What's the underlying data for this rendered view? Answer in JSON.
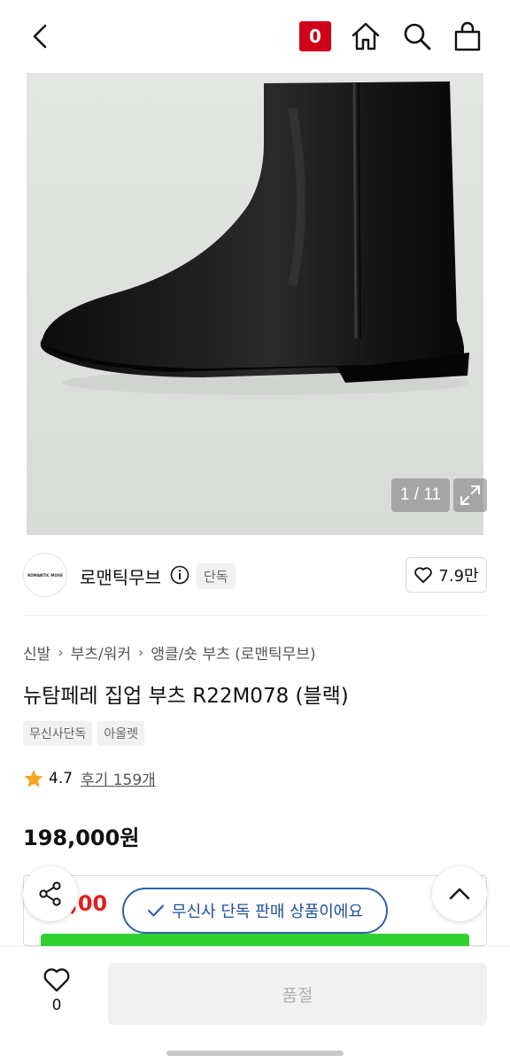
{
  "nav": {
    "cart_count": "0",
    "icons": [
      "back-arrow-icon",
      "home-icon",
      "search-icon",
      "shopping-bag-icon"
    ]
  },
  "gallery": {
    "counter": "1 / 11",
    "background": "#e0e2e0"
  },
  "brand": {
    "logo_text": "ROMANTIC MOVE",
    "name": "로맨틱무브",
    "tag": "단독",
    "likes": "7.9만"
  },
  "product": {
    "breadcrumb": [
      "신발",
      "부츠/워커",
      "앵클/숏 부츠 (로맨틱무브)"
    ],
    "title": "뉴탐페레 집업 부츠 R22M078 (블랙)",
    "tags": [
      "무신사단독",
      "아울렛"
    ],
    "rating": "4.7",
    "reviews": "후기 159개",
    "price": "198,000원"
  },
  "coupon": {
    "partial_price": "3,00",
    "exclusive_notice": "무신사 단독 판매 상품이에요"
  },
  "bottom_bar": {
    "heart_count": "0",
    "soldout_label": "품절"
  },
  "colors": {
    "badge_red": "#d0021b",
    "accent_blue": "#2d5fae",
    "sale_red": "#e02020",
    "green": "#2fd22f",
    "star": "#f5a623"
  }
}
